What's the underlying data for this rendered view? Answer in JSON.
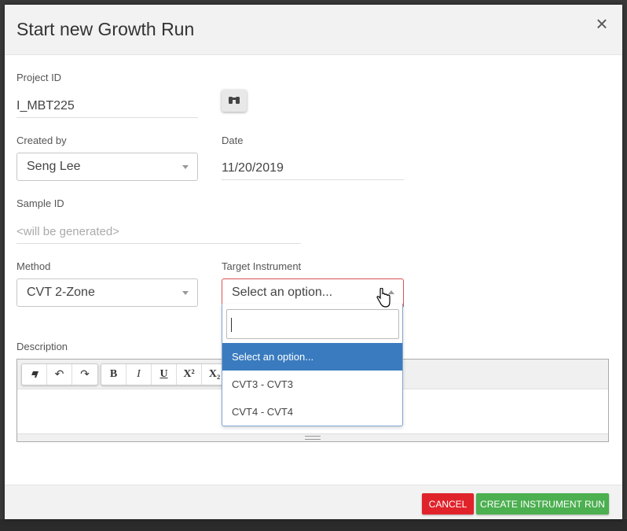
{
  "dialog": {
    "title": "Start new Growth Run",
    "close_symbol": "×"
  },
  "form": {
    "project_id": {
      "label": "Project ID",
      "value": "I_MBT225"
    },
    "created_by": {
      "label": "Created by",
      "value": "Seng Lee"
    },
    "date": {
      "label": "Date",
      "value": "11/20/2019"
    },
    "sample_id": {
      "label": "Sample ID",
      "placeholder": "<will be generated>"
    },
    "method": {
      "label": "Method",
      "value": "CVT 2-Zone"
    },
    "target_instrument": {
      "label": "Target Instrument",
      "value": "Select an option...",
      "options": [
        "Select an option...",
        "CVT3 - CVT3",
        "CVT4 - CVT4"
      ],
      "selected_index": 0
    },
    "description": {
      "label": "Description"
    }
  },
  "editor_toolbar": {
    "eraser": "eraser-icon",
    "undo": "↶",
    "redo": "↷",
    "bold": "B",
    "italic": "I",
    "underline": "U",
    "superscript": "X²",
    "subscript": "X₂"
  },
  "footer": {
    "cancel_label": "CANCEL",
    "create_label": "CREATE INSTRUMENT RUN"
  },
  "colors": {
    "cancel": "#e0232b",
    "create": "#4caf50",
    "option_highlight": "#3a7bbf",
    "invalid_border": "#d9534f"
  }
}
